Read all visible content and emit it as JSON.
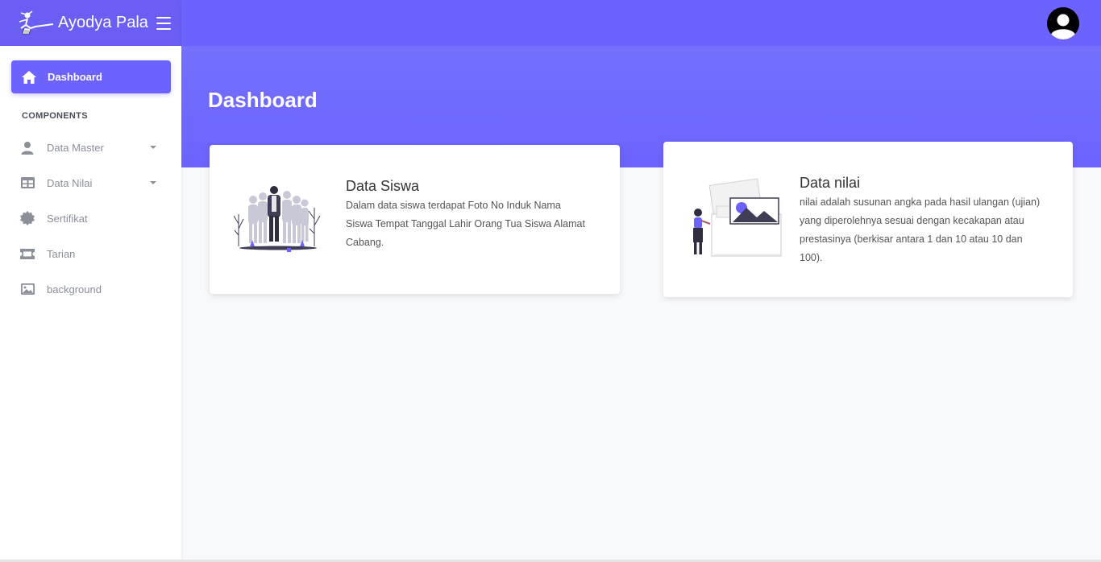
{
  "brand": {
    "name": "Ayodya Pala",
    "logo_icon": "dancer-logo-icon"
  },
  "navbar": {
    "menu_icon": "hamburger-icon",
    "avatar_icon": "user-avatar-icon"
  },
  "sidebar": {
    "active_item": {
      "label": "Dashboard",
      "icon": "home-icon"
    },
    "section_heading": "COMPONENTS",
    "items": [
      {
        "label": "Data Master",
        "icon": "user-icon",
        "has_dropdown": true
      },
      {
        "label": "Data Nilai",
        "icon": "table-icon",
        "has_dropdown": true
      },
      {
        "label": "Sertifikat",
        "icon": "certificate-icon",
        "has_dropdown": false
      },
      {
        "label": "Tarian",
        "icon": "ticket-icon",
        "has_dropdown": false
      },
      {
        "label": "background",
        "icon": "image-icon",
        "has_dropdown": false
      }
    ]
  },
  "main": {
    "page_title": "Dashboard",
    "cards": [
      {
        "title": "Data Siswa",
        "description": "Dalam data siswa terdapat Foto No Induk Nama Siswa Tempat Tanggal Lahir Orang Tua Siswa Alamat Cabang."
      },
      {
        "title": "Data nilai",
        "description": "nilai adalah susunan angka pada hasil ulangan (ujian) yang diperolehnya sesuai dengan kecakapan atau prestasinya (berkisar antara 1 dan 10 atau 10 dan 100)."
      }
    ]
  },
  "colors": {
    "primary": "#6c63ff",
    "sidebar_bg": "#ffffff",
    "content_bg": "#f8f9fb"
  }
}
